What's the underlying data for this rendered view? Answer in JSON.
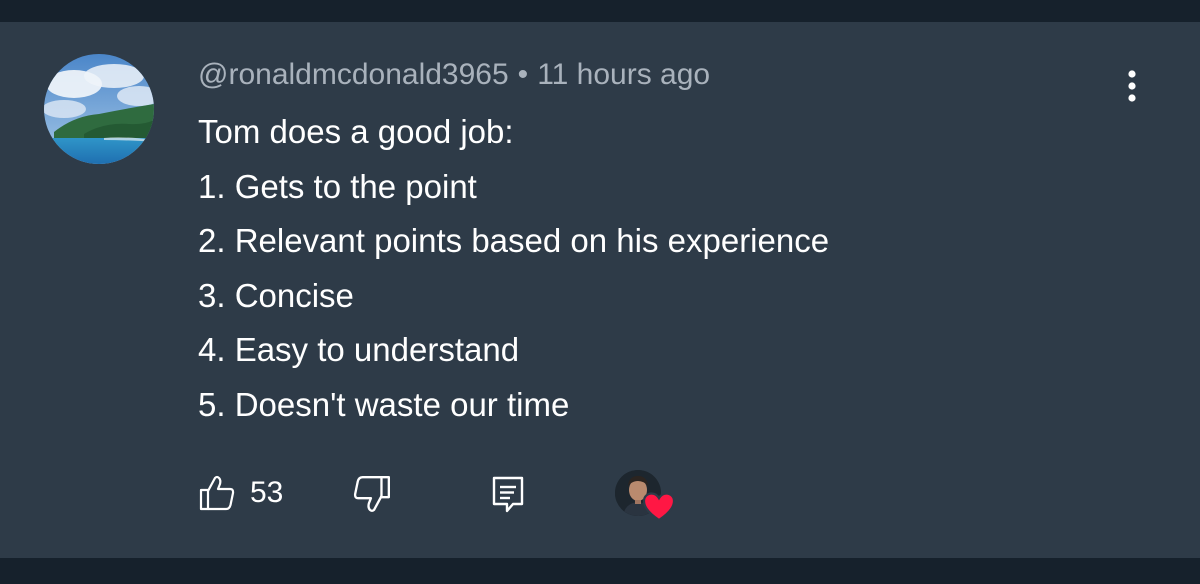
{
  "comment": {
    "author": "@ronaldmcdonald3965",
    "separator": "•",
    "timestamp": "11 hours ago",
    "lines": [
      "Tom does a good job:",
      "1. Gets to the point",
      "2. Relevant points based on his experience",
      "3. Concise",
      "4. Easy to understand",
      "5. Doesn't waste our time"
    ],
    "like_count": "53"
  },
  "icons": {
    "like": "thumbs-up-icon",
    "dislike": "thumbs-down-icon",
    "reply": "reply-icon",
    "menu": "more-vert-icon",
    "heart": "heart-icon"
  },
  "colors": {
    "background": "#2e3b48",
    "band": "#16212c",
    "text": "#ffffff",
    "meta_text": "#a9b2bc",
    "heart": "#ff1744"
  }
}
